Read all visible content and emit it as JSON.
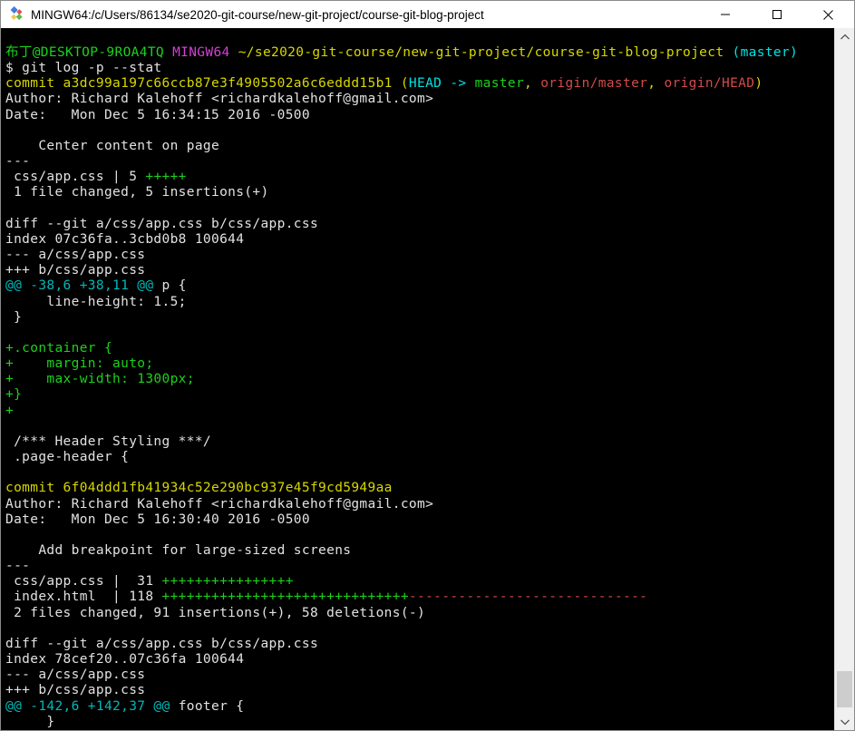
{
  "window": {
    "title": "MINGW64:/c/Users/86134/se2020-git-course/new-git-project/course-git-blog-project",
    "icon": "msys2-diamonds-icon",
    "icon_colors": {
      "blue": "#3f7edb",
      "red": "#e05252",
      "yellow": "#f0c54a",
      "green": "#5cb84e"
    },
    "controls": [
      {
        "name": "minimize",
        "glyph": "–"
      },
      {
        "name": "maximize",
        "glyph": "□"
      },
      {
        "name": "close",
        "glyph": "✕"
      }
    ]
  },
  "terminal": {
    "background": "#000000",
    "palette": {
      "w": "#e2e2e2",
      "g": "#1bd21b",
      "y": "#d7d700",
      "m": "#d63fd6",
      "c": "#00e3e3",
      "t": "#00b9b9",
      "r": "#d24a4a"
    },
    "lines": [
      [
        [
          "布丁@DESKTOP-9ROA4TQ ",
          "g"
        ],
        [
          "MINGW64 ",
          "m"
        ],
        [
          "~/se2020-git-course/new-git-project/course-git-blog-project ",
          "y"
        ],
        [
          "(master)",
          "c"
        ]
      ],
      [
        [
          "$ git log -p --stat",
          "w"
        ]
      ],
      [
        [
          "commit a3dc99a197c66ccb87e3f4905502a6c6eddd15b1 (",
          "y"
        ],
        [
          "HEAD -> ",
          "c"
        ],
        [
          "master",
          "g"
        ],
        [
          ", ",
          "y"
        ],
        [
          "origin/master",
          "r"
        ],
        [
          ", ",
          "y"
        ],
        [
          "origin/HEAD",
          "r"
        ],
        [
          ")",
          "y"
        ]
      ],
      [
        [
          "Author: Richard Kalehoff <richardkalehoff@gmail.com>",
          "w"
        ]
      ],
      [
        [
          "Date:   Mon Dec 5 16:34:15 2016 -0500",
          "w"
        ]
      ],
      [],
      [
        [
          "    Center content on page",
          "w"
        ]
      ],
      [
        [
          "---",
          "w"
        ]
      ],
      [
        [
          " css/app.css | 5 ",
          "w"
        ],
        [
          "+++++",
          "g"
        ]
      ],
      [
        [
          " 1 file changed, 5 insertions(+)",
          "w"
        ]
      ],
      [],
      [
        [
          "diff --git a/css/app.css b/css/app.css",
          "w"
        ]
      ],
      [
        [
          "index 07c36fa..3cbd0b8 100644",
          "w"
        ]
      ],
      [
        [
          "--- a/css/app.css",
          "w"
        ]
      ],
      [
        [
          "+++ b/css/app.css",
          "w"
        ]
      ],
      [
        [
          "@@ -38,6 +38,11 @@",
          "t"
        ],
        [
          " p {",
          "w"
        ]
      ],
      [
        [
          "     line-height: 1.5;",
          "w"
        ]
      ],
      [
        [
          " }",
          "w"
        ]
      ],
      [],
      [
        [
          "+.container {",
          "g"
        ]
      ],
      [
        [
          "+    margin: auto;",
          "g"
        ]
      ],
      [
        [
          "+    max-width: 1300px;",
          "g"
        ]
      ],
      [
        [
          "+}",
          "g"
        ]
      ],
      [
        [
          "+",
          "g"
        ]
      ],
      [],
      [
        [
          " /*** Header Styling ***/",
          "w"
        ]
      ],
      [
        [
          " .page-header {",
          "w"
        ]
      ],
      [],
      [
        [
          "commit 6f04ddd1fb41934c52e290bc937e45f9cd5949aa",
          "y"
        ]
      ],
      [
        [
          "Author: Richard Kalehoff <richardkalehoff@gmail.com>",
          "w"
        ]
      ],
      [
        [
          "Date:   Mon Dec 5 16:30:40 2016 -0500",
          "w"
        ]
      ],
      [],
      [
        [
          "    Add breakpoint for large-sized screens",
          "w"
        ]
      ],
      [
        [
          "---",
          "w"
        ]
      ],
      [
        [
          " css/app.css |  31 ",
          "w"
        ],
        [
          "++++++++++++++++",
          "g"
        ]
      ],
      [
        [
          " index.html  | 118 ",
          "w"
        ],
        [
          "++++++++++++++++++++++++++++++",
          "g"
        ],
        [
          "-----------------------------",
          "r"
        ]
      ],
      [
        [
          " 2 files changed, 91 insertions(+), 58 deletions(-)",
          "w"
        ]
      ],
      [],
      [
        [
          "diff --git a/css/app.css b/css/app.css",
          "w"
        ]
      ],
      [
        [
          "index 78cef20..07c36fa 100644",
          "w"
        ]
      ],
      [
        [
          "--- a/css/app.css",
          "w"
        ]
      ],
      [
        [
          "+++ b/css/app.css",
          "w"
        ]
      ],
      [
        [
          "@@ -142,6 +142,37 @@",
          "t"
        ],
        [
          " footer {",
          "w"
        ]
      ],
      [
        [
          "     }",
          "w"
        ]
      ]
    ]
  },
  "scrollbar": {
    "orientation": "vertical",
    "thumb_position": "near-bottom",
    "track_color": "#f0f0f0",
    "thumb_color": "#cdcdcd"
  }
}
